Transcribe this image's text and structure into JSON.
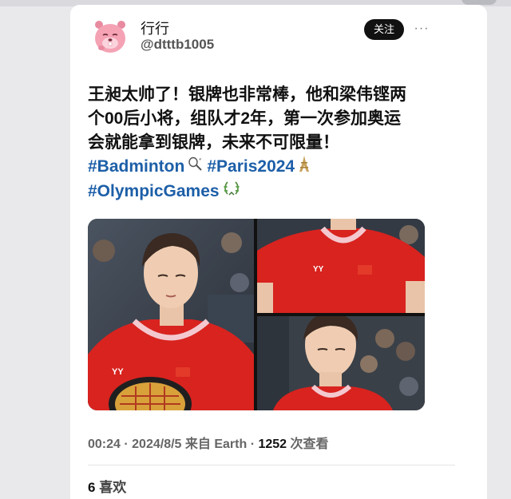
{
  "user": {
    "display_name": "行行",
    "handle": "@dtttb1005",
    "follow_label": "关注",
    "more_label": "···"
  },
  "post": {
    "line1": "王昶太帅了！银牌也非常棒，他和梁伟铿两",
    "line2": "个00后小将，组队才2年，第一次参加奥运",
    "line3": "会就能拿到银牌，未来不可限量！",
    "hashtag1": "#Badminton",
    "hashtag2": "#Paris2024",
    "hashtag3": "#OlympicGames",
    "emoji1": "badminton-racket-icon",
    "emoji2": "eiffel-tower-icon",
    "emoji3": "laurel-wreath-icon"
  },
  "media": {
    "count": 3,
    "jersey_color": "#d8231f",
    "brand_text": "YY"
  },
  "meta": {
    "time": "00:24",
    "dot": "·",
    "date": "2024/8/5",
    "source": "来自 Earth",
    "views": "1252",
    "views_label": "次查看"
  },
  "likes": {
    "count": "6",
    "label": "喜欢"
  },
  "colors": {
    "hashtag": "#1d5fa8",
    "text": "#111111",
    "muted": "#666666"
  }
}
